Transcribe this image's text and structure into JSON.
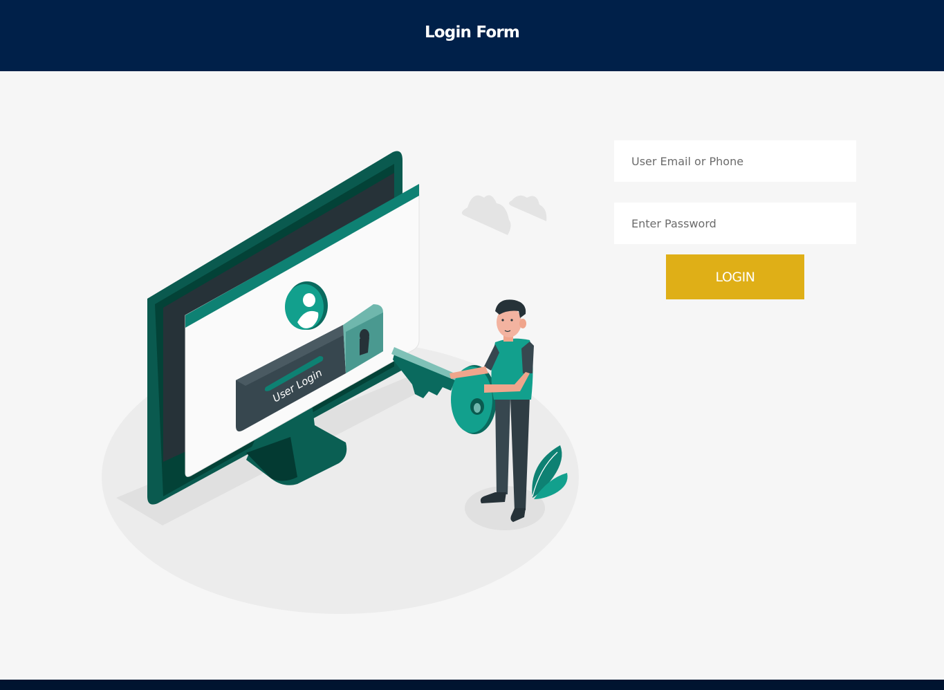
{
  "header": {
    "title": "Login Form"
  },
  "illustration": {
    "screen_label": "User Login"
  },
  "form": {
    "email_placeholder": "User Email or Phone",
    "password_placeholder": "Enter Password",
    "login_label": "LOGIN"
  },
  "colors": {
    "header_bg": "#002049",
    "page_bg": "#f6f6f6",
    "accent_teal": "#0e8173",
    "button_bg": "#dfaf17",
    "footer_bg": "#001430"
  }
}
